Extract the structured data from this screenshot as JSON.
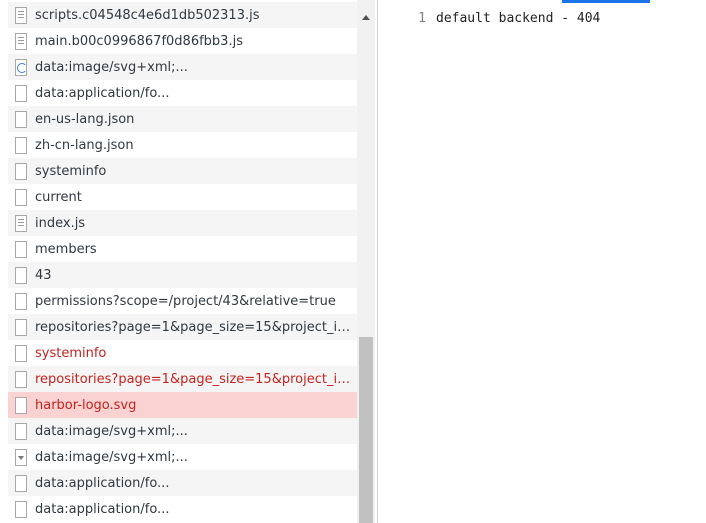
{
  "requests": [
    {
      "name": "scripts.c04548c4e6d1db502313.js",
      "icon": "script-file-icon",
      "status": "normal"
    },
    {
      "name": "main.b00c0996867f0d86fbb3.js",
      "icon": "script-file-icon",
      "status": "normal"
    },
    {
      "name": "data:image/svg+xml;...",
      "icon": "loading-image-icon",
      "status": "normal"
    },
    {
      "name": "data:application/fo...",
      "icon": "document-file-icon",
      "status": "normal"
    },
    {
      "name": "en-us-lang.json",
      "icon": "document-file-icon",
      "status": "normal"
    },
    {
      "name": "zh-cn-lang.json",
      "icon": "document-file-icon",
      "status": "normal"
    },
    {
      "name": "systeminfo",
      "icon": "document-file-icon",
      "status": "normal"
    },
    {
      "name": "current",
      "icon": "document-file-icon",
      "status": "normal"
    },
    {
      "name": "index.js",
      "icon": "script-file-icon",
      "status": "normal"
    },
    {
      "name": "members",
      "icon": "document-file-icon",
      "status": "normal"
    },
    {
      "name": "43",
      "icon": "document-file-icon",
      "status": "normal"
    },
    {
      "name": "permissions?scope=/project/43&relative=true",
      "icon": "document-file-icon",
      "status": "normal"
    },
    {
      "name": "repositories?page=1&page_size=15&project_id...",
      "icon": "document-file-icon",
      "status": "normal"
    },
    {
      "name": "systeminfo",
      "icon": "document-file-icon",
      "status": "error"
    },
    {
      "name": "repositories?page=1&page_size=15&project_id...",
      "icon": "document-file-icon",
      "status": "error"
    },
    {
      "name": "harbor-logo.svg",
      "icon": "document-file-icon",
      "status": "selected"
    },
    {
      "name": "data:image/svg+xml;...",
      "icon": "document-file-icon",
      "status": "normal"
    },
    {
      "name": "data:image/svg+xml;...",
      "icon": "image-file-icon",
      "status": "normal"
    },
    {
      "name": "data:application/fo...",
      "icon": "document-file-icon",
      "status": "normal"
    },
    {
      "name": "data:application/fo...",
      "icon": "document-file-icon",
      "status": "normal"
    }
  ],
  "response": {
    "lines": [
      {
        "number": "1",
        "text": "default backend - 404"
      }
    ]
  },
  "colors": {
    "error_text": "#c5221f",
    "selected_row": "#fad2d2",
    "active_tab": "#1a73e8"
  }
}
